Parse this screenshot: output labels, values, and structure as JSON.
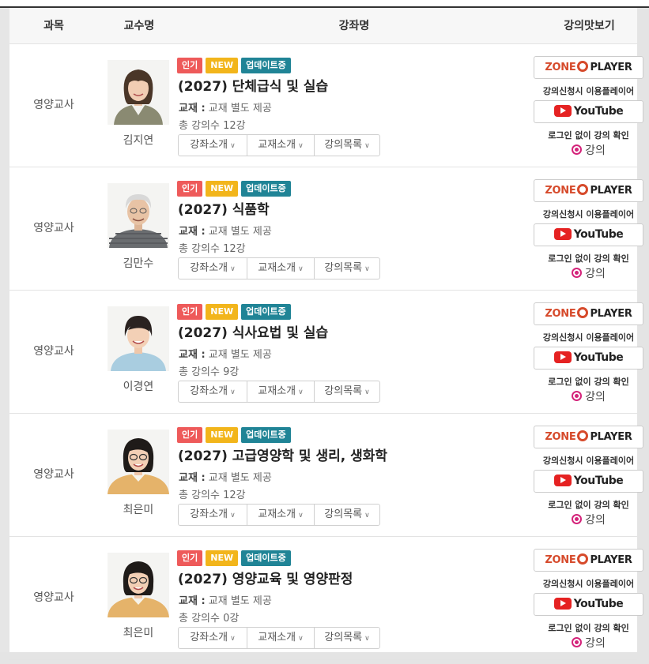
{
  "header": {
    "subject": "과목",
    "professor": "교수명",
    "course": "강좌명",
    "preview": "강의맛보기"
  },
  "badges": {
    "hot": "인기",
    "new": "NEW",
    "updating": "업데이트중"
  },
  "labels": {
    "book_label": "교재 :",
    "book_text": "교재 별도 제공",
    "intro": "강좌소개",
    "book_intro": "교재소개",
    "lecture_list": "강의목록",
    "zone_a": "ZONE",
    "zone_b": "PLAYER",
    "player_caption": "강의신청시 이용플레이어",
    "youtube": "YouTube",
    "youtube_caption": "로그인 없이 강의 확인",
    "sample": "강의"
  },
  "colors": {
    "hot": "#ee5a5a",
    "new": "#f2b51b",
    "updating": "#208496",
    "zone_accent": "#d64a2b",
    "youtube_red": "#e52222",
    "sample_magenta": "#d4237a"
  },
  "rows": [
    {
      "subject": "영양교사",
      "professor": "김지연",
      "title": "(2027) 단체급식 및 실습",
      "count": "총 강의수 12강"
    },
    {
      "subject": "영양교사",
      "professor": "김만수",
      "title": "(2027) 식품학",
      "count": "총 강의수 12강"
    },
    {
      "subject": "영양교사",
      "professor": "이경연",
      "title": "(2027) 식사요법 및 실습",
      "count": "총 강의수 9강"
    },
    {
      "subject": "영양교사",
      "professor": "최은미",
      "title": "(2027) 고급영양학 및 생리, 생화학",
      "count": "총 강의수 12강"
    },
    {
      "subject": "영양교사",
      "professor": "최은미",
      "title": "(2027) 영양교육 및 영양판정",
      "count": "총 강의수 0강"
    }
  ]
}
